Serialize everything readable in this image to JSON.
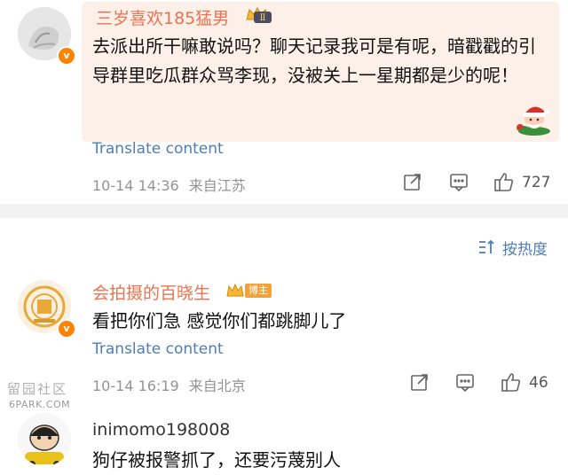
{
  "comments": [
    {
      "username": "三岁喜欢185猛男",
      "level_badge": "Ⅱ",
      "text": "去派出所干嘛敢说吗？聊天记录我可是有呢，暗戳戳的引导群里吃瓜群众骂李现，没被关上一星期都是少的呢！",
      "translate": "Translate content",
      "time": "10-14 14:36",
      "location": "来自江苏",
      "likes": "727"
    },
    {
      "username": "会拍摄的百晓生",
      "tag": "博主",
      "text": "看把你们急 感觉你们都跳脚儿了",
      "translate": "Translate content",
      "time": "10-14 16:19",
      "location": "来自北京",
      "likes": "46"
    },
    {
      "username": "inimomo198008",
      "text": "狗仔被报警抓了，还要污蔑别人"
    }
  ],
  "sort_label": "按热度",
  "watermark": {
    "text": "留园社区",
    "url": "6PARK.COM"
  },
  "colors": {
    "accent_orange": "#eb7350",
    "link_blue": "#4f7db5",
    "bubble_bg": "#fdf0e9",
    "divider": "#f2f2f2"
  },
  "icons": [
    "share-icon",
    "comment-icon",
    "like-icon",
    "sort-icon",
    "verified-badge-icon",
    "santa-emoji-icon"
  ]
}
